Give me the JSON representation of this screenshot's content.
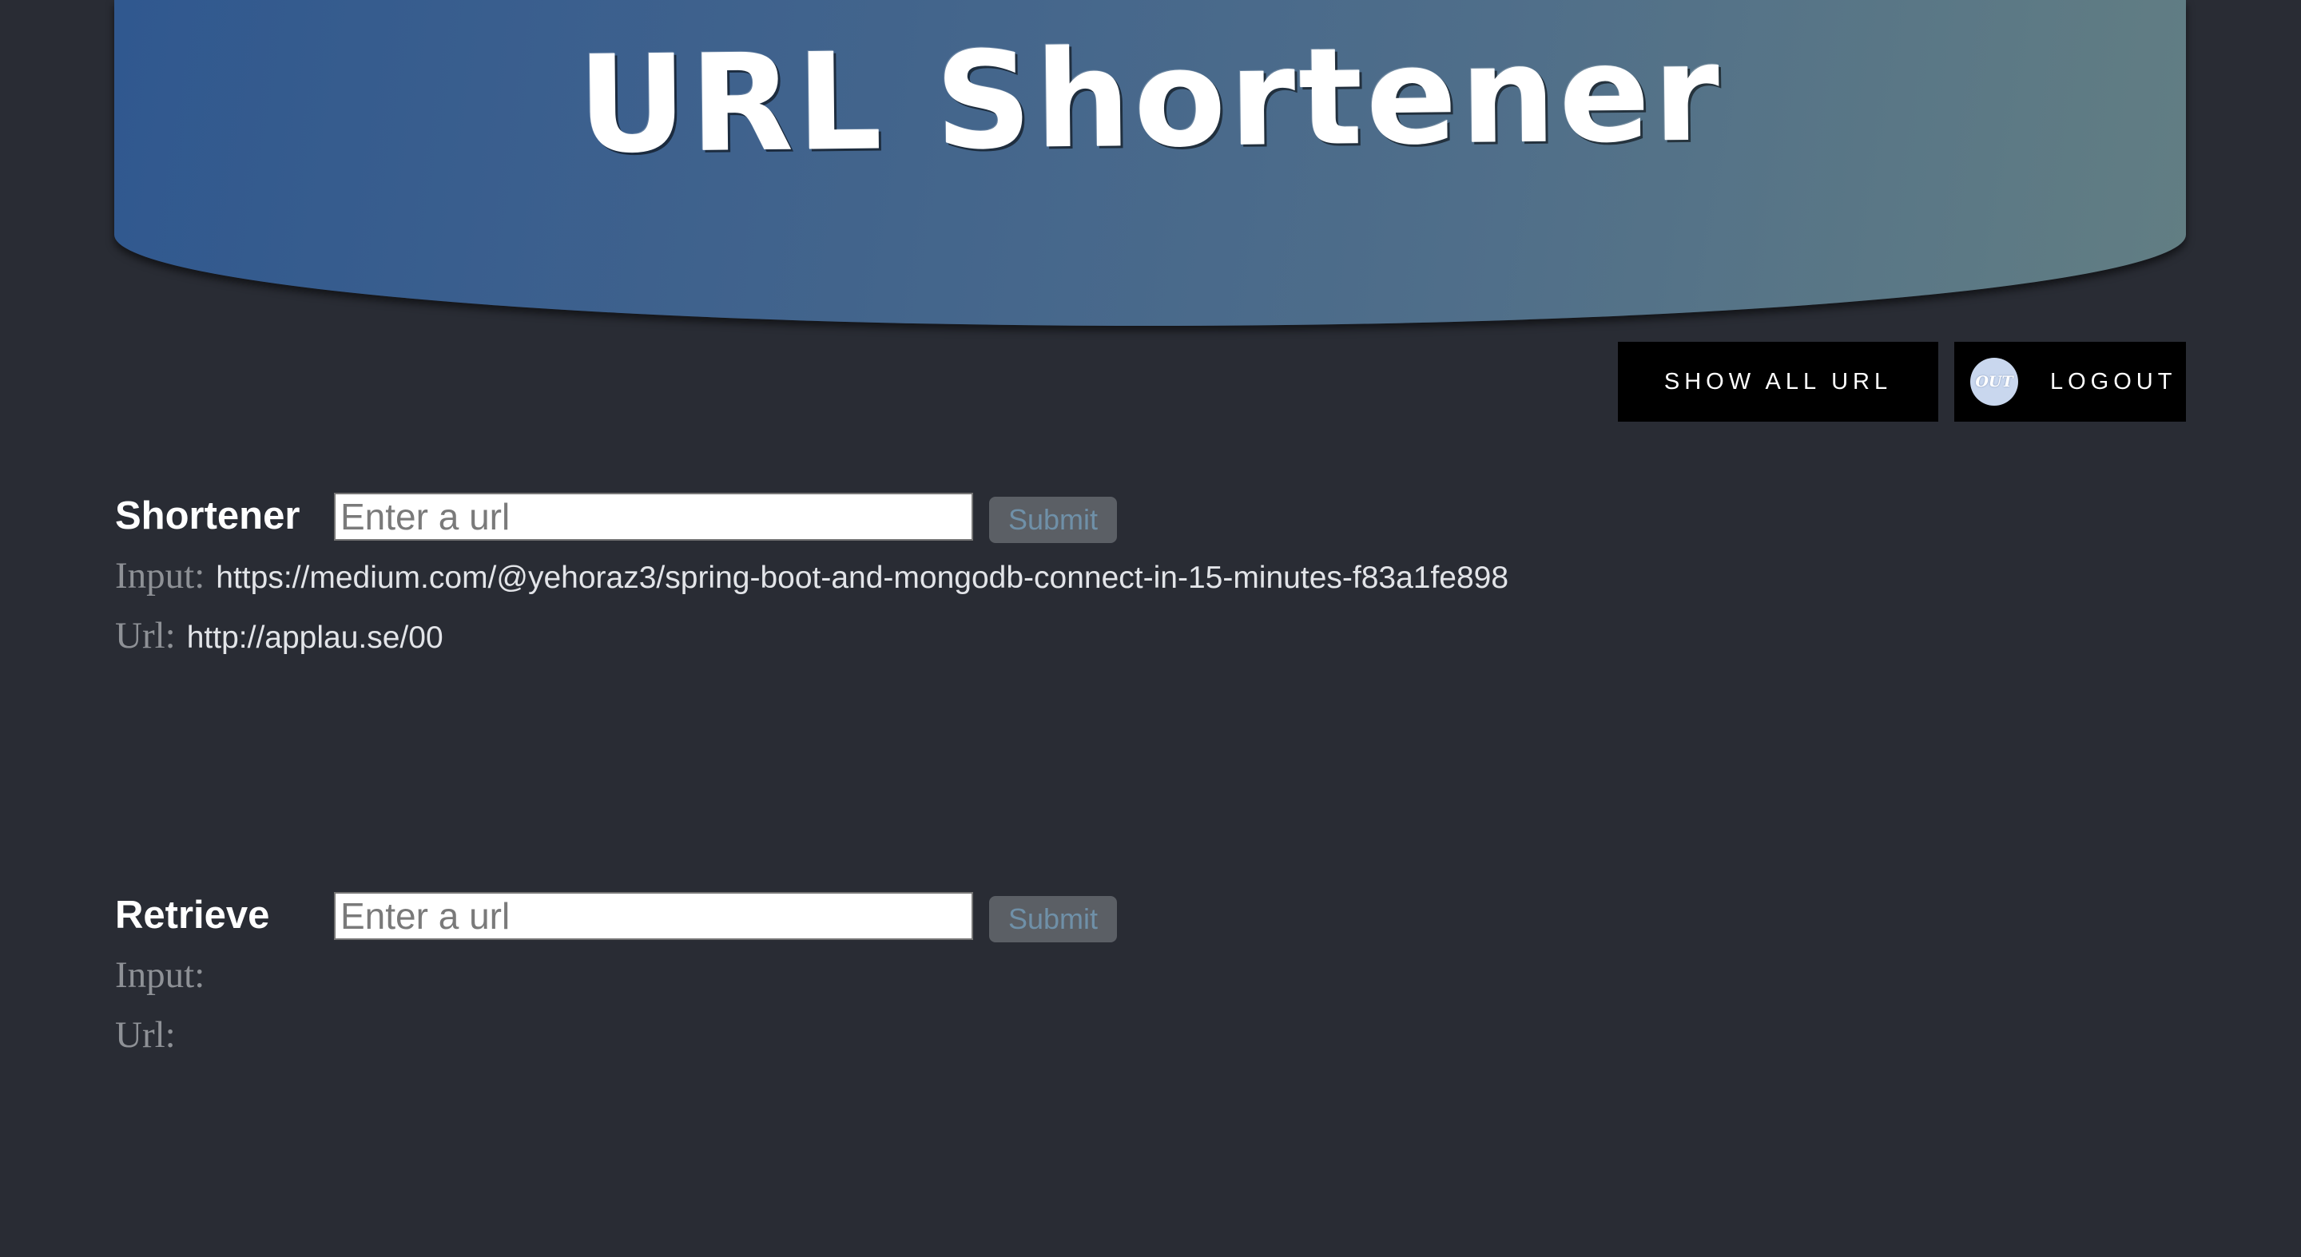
{
  "header": {
    "title": "URL Shortener"
  },
  "nav": {
    "show_all_label": "SHOW ALL URL",
    "logout_badge": "OUT",
    "logout_label": "LOGOUT"
  },
  "shortener": {
    "label": "Shortener",
    "input_placeholder": "Enter a url",
    "submit_label": "Submit",
    "input_row_label": "Input:",
    "input_value": "https://medium.com/@yehoraz3/spring-boot-and-mongodb-connect-in-15-minutes-f83a1fe898",
    "url_row_label": "Url:",
    "url_value": "http://applau.se/00"
  },
  "retrieve": {
    "label": "Retrieve",
    "input_placeholder": "Enter a url",
    "submit_label": "Submit",
    "input_row_label": "Input:",
    "input_value": "",
    "url_row_label": "Url:",
    "url_value": ""
  }
}
